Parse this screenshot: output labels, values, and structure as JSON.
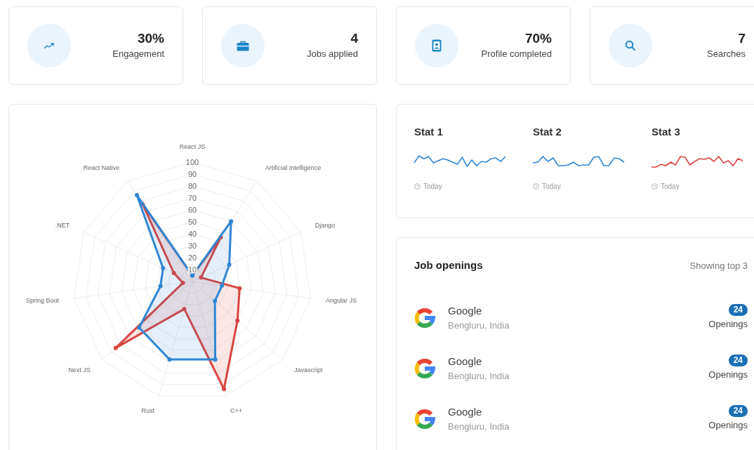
{
  "summary_cards": [
    {
      "value": "30%",
      "label": "Engagement"
    },
    {
      "value": "4",
      "label": "Jobs applied"
    },
    {
      "value": "70%",
      "label": "Profile completed"
    },
    {
      "value": "7",
      "label": "Searches"
    }
  ],
  "skills_chart": {
    "chart_data": {
      "type": "radar",
      "categories": [
        "React JS",
        "Artificial Intelligence",
        "Django",
        "Angular JS",
        "Javascript",
        "C++",
        "Rust",
        "Next JS",
        "Spring Boot",
        ".NET",
        "React Native"
      ],
      "ylim": [
        0,
        100
      ],
      "yticks": [
        10,
        20,
        30,
        40,
        50,
        60,
        70,
        80,
        90,
        100
      ],
      "series": [
        {
          "color": "#d9443f",
          "values": [
            5,
            44,
            8,
            40,
            50,
            94,
            24,
            85,
            8,
            17,
            77
          ]
        },
        {
          "color": "#2f86d4",
          "values": [
            5,
            60,
            34,
            25,
            25,
            68,
            68,
            59,
            27,
            27,
            86
          ]
        }
      ]
    }
  },
  "stats": [
    {
      "title": "Stat 1",
      "color": "#2f86d4",
      "caption": "Today"
    },
    {
      "title": "Stat 2",
      "color": "#2f86d4",
      "caption": "Today"
    },
    {
      "title": "Stat 3",
      "color": "#d9443f",
      "caption": "Today"
    }
  ],
  "job_openings": {
    "title": "Job openings",
    "note": "Showing top 3",
    "rows": [
      {
        "company": "Google",
        "location": "Bengluru, India",
        "count": "24",
        "count_label": "Openings"
      },
      {
        "company": "Google",
        "location": "Bengluru, India",
        "count": "24",
        "count_label": "Openings"
      },
      {
        "company": "Google",
        "location": "Bengluru, India",
        "count": "24",
        "count_label": "Openings"
      }
    ]
  }
}
